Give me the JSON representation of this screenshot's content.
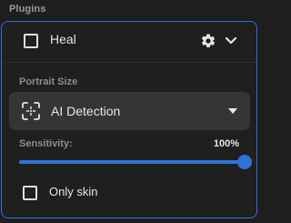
{
  "section": {
    "title": "Plugins"
  },
  "plugin": {
    "name": "Heal",
    "enabled": false,
    "settings_icon": "gear-icon",
    "expand_icon": "chevron-down-icon"
  },
  "portrait": {
    "title": "Portrait Size",
    "dropdown": {
      "selected": "AI Detection",
      "icon": "focus-frame-icon",
      "caret_icon": "caret-down-icon"
    }
  },
  "sensitivity": {
    "label": "Sensitivity:",
    "value_text": "100%",
    "value": 1.0
  },
  "only_skin": {
    "label": "Only skin",
    "checked": false
  },
  "colors": {
    "accent": "#2f72d6",
    "background": "#1e1e1e",
    "dropdown_bg": "#353535"
  }
}
